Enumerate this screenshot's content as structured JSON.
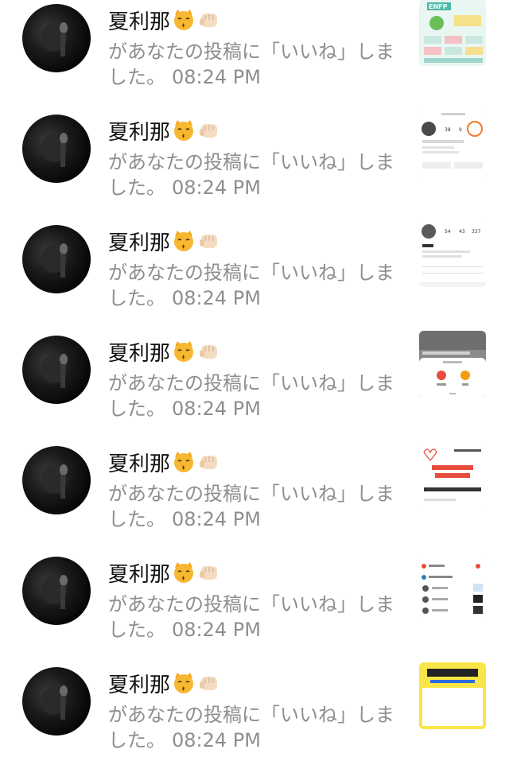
{
  "notifications": [
    {
      "user": "夏利那",
      "message": "があなたの投稿に「いいね」しました。",
      "time": "08:24 PM",
      "thumb_text": "ENFP"
    },
    {
      "user": "夏利那",
      "message": "があなたの投稿に「いいね」しました。",
      "time": "08:24 PM",
      "thumb_text": ""
    },
    {
      "user": "夏利那",
      "message": "があなたの投稿に「いいね」しました。",
      "time": "08:24 PM",
      "thumb_text": ""
    },
    {
      "user": "夏利那",
      "message": "があなたの投稿に「いいね」しました。",
      "time": "08:24 PM",
      "thumb_text": ""
    },
    {
      "user": "夏利那",
      "message": "があなたの投稿に「いいね」しました。",
      "time": "08:24 PM",
      "thumb_text": ""
    },
    {
      "user": "夏利那",
      "message": "があなたの投稿に「いいね」しました。",
      "time": "08:24 PM",
      "thumb_text": ""
    },
    {
      "user": "夏利那",
      "message": "があなたの投稿に「いいね」しました。",
      "time": "08:24 PM",
      "thumb_text": ""
    }
  ],
  "icons": {
    "name_emoji_1": "kissing-cat-emoji-icon",
    "name_emoji_2": "fist-bump-emoji-icon"
  },
  "colors": {
    "name_text": "#111111",
    "message_text": "#8e8e8e",
    "background": "#ffffff"
  }
}
